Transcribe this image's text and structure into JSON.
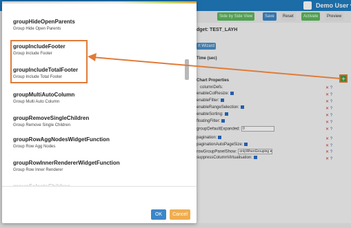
{
  "app": {
    "user_label": "Demo User ▾",
    "toolbar": {
      "side_by_side": "Side by Side View",
      "save": "Save",
      "reset": "Reset",
      "activate": "Activate",
      "preview": "Preview"
    },
    "widget_title": "dget: TEST_LAYH",
    "wizard_label": "rt Wizard",
    "time_label": "Time (sec)",
    "chart_properties_label": "Chart Properties",
    "properties": [
      {
        "label": "columnDefs:",
        "has_checkbox": false
      },
      {
        "label": "enableColResize:",
        "has_checkbox": true
      },
      {
        "label": "enableFilter:",
        "has_checkbox": true
      },
      {
        "label": "enableRangeSelection:",
        "has_checkbox": true
      },
      {
        "label": "enableSorting:",
        "has_checkbox": true
      },
      {
        "label": "floatingFilter:",
        "has_checkbox": true
      },
      {
        "label": "groupDefaultExpanded:",
        "input_value": "0"
      },
      {
        "label": "pagination:",
        "has_checkbox": true
      },
      {
        "label": "paginationAutoPageSize:",
        "has_checkbox": true
      },
      {
        "label": "rowGroupPanelShow:",
        "input_value": "onlyWhenGrouping ▾"
      },
      {
        "label": "suppressColumnVirtualisation:",
        "has_checkbox": true
      }
    ],
    "colors": {
      "topbar": "#1f7bbf",
      "add_button": "#3a9d3a",
      "highlight": "#e07b39"
    }
  },
  "modal": {
    "items": [
      {
        "name": "groupHideOpenParents",
        "desc": "Group Hide Open Parents"
      },
      {
        "name": "groupIncludeFooter",
        "desc": "Group Include Footer"
      },
      {
        "name": "groupIncludeTotalFooter",
        "desc": "Group Include Total Footer"
      },
      {
        "name": "groupMultiAutoColumn",
        "desc": "Group Multi Auto Column"
      },
      {
        "name": "groupRemoveSingleChildren",
        "desc": "Group Remove Single Children"
      },
      {
        "name": "groupRowAggNodesWidgetFunction",
        "desc": "Group Row Agg Nodes"
      },
      {
        "name": "groupRowInnerRendererWidgetFunction",
        "desc": "Group Row Inner Renderer"
      },
      {
        "name": "groupSelectsChildren",
        "desc": ""
      }
    ],
    "ok_label": "OK",
    "cancel_label": "Cancel",
    "colors": {
      "ok": "#3c86c8",
      "cancel": "#f0ad4e"
    }
  }
}
